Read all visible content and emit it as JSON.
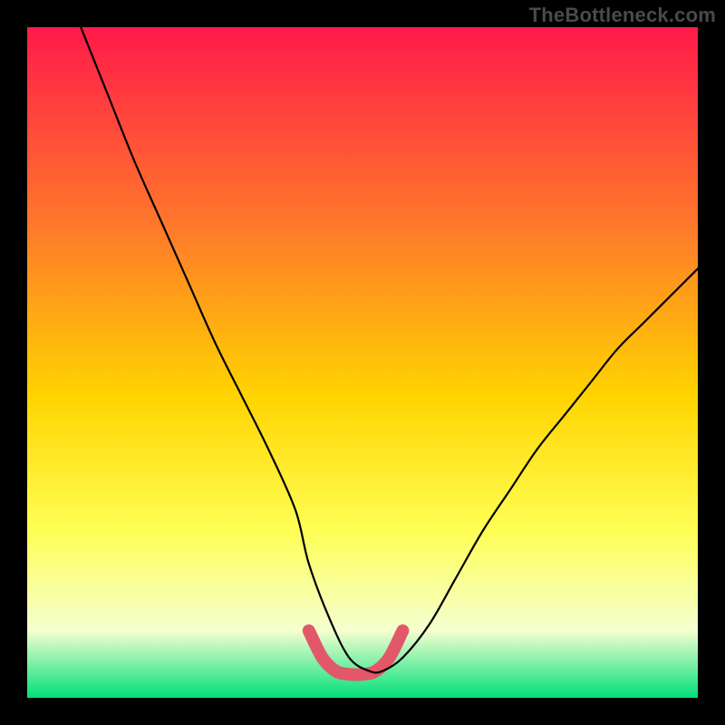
{
  "attribution": "TheBottleneck.com",
  "colors": {
    "frame": "#000000",
    "grad_top": "#ff1a4a",
    "grad_mid1": "#ff7a2a",
    "grad_mid2": "#ffd400",
    "grad_mid3": "#ffff55",
    "grad_low": "#f4ffd0",
    "grad_bottom": "#00e07a",
    "curve": "#000000",
    "valley": "#e2576a"
  },
  "chart_data": {
    "type": "line",
    "title": "",
    "xlabel": "",
    "ylabel": "",
    "xlim": [
      0,
      100
    ],
    "ylim": [
      0,
      100
    ],
    "series": [
      {
        "name": "bottleneck-curve",
        "x": [
          8,
          12,
          16,
          20,
          24,
          28,
          32,
          36,
          40,
          42,
          45,
          48,
          51,
          53,
          56,
          60,
          64,
          68,
          72,
          76,
          80,
          84,
          88,
          92,
          96,
          100
        ],
        "y": [
          100,
          90,
          80,
          71,
          62,
          53,
          45,
          37,
          28,
          20,
          12,
          6,
          4,
          4,
          6,
          11,
          18,
          25,
          31,
          37,
          42,
          47,
          52,
          56,
          60,
          64
        ]
      },
      {
        "name": "valley-highlight",
        "x": [
          42,
          44,
          46,
          48,
          50,
          52,
          54,
          56
        ],
        "y": [
          10,
          6,
          4,
          3.5,
          3.5,
          4,
          6,
          10
        ]
      }
    ],
    "gradient_stops": [
      {
        "pos": 0.0,
        "color": "#ff1a4a"
      },
      {
        "pos": 0.3,
        "color": "#ff7a2a"
      },
      {
        "pos": 0.55,
        "color": "#ffd400"
      },
      {
        "pos": 0.75,
        "color": "#ffff55"
      },
      {
        "pos": 0.9,
        "color": "#f4ffd0"
      },
      {
        "pos": 1.0,
        "color": "#00e07a"
      }
    ]
  }
}
